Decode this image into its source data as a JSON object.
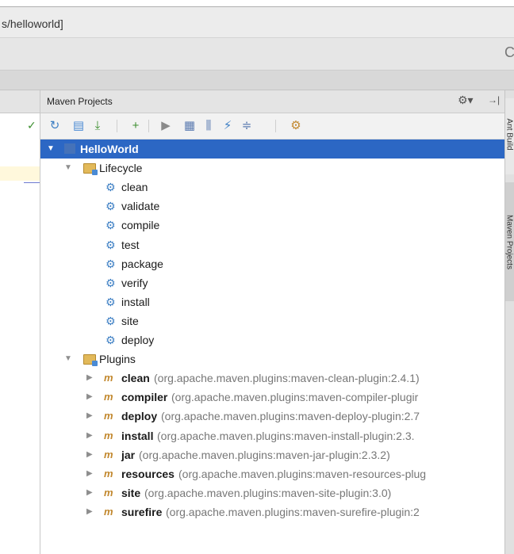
{
  "window": {
    "title": "s/helloworld]",
    "toolbar_cut_glyph": "C"
  },
  "editor": {
    "check_mark": "✓"
  },
  "panel": {
    "title": "Maven Projects",
    "header_icons": [
      "gear-icon",
      "hide-panel-icon"
    ],
    "toolbar": [
      {
        "name": "reimport-button",
        "icon": "refresh-icon",
        "glyph": "↻",
        "color": "#3d7fc4"
      },
      {
        "name": "generate-sources-button",
        "icon": "folder-refresh-icon",
        "glyph": "▤",
        "color": "#4a8ad4"
      },
      {
        "name": "download-sources-button",
        "icon": "download-icon",
        "glyph": "⤓",
        "color": "#3c8f2f"
      },
      {
        "name": "add-project-button",
        "icon": "plus-icon",
        "glyph": "+",
        "color": "#3c8f2f"
      },
      {
        "name": "run-build-button",
        "icon": "play-icon",
        "glyph": "▶",
        "color": "#8a8a8a"
      },
      {
        "name": "execute-goal-button",
        "icon": "maven-goal-icon",
        "glyph": "▦",
        "color": "#5b7bb0"
      },
      {
        "name": "toggle-offline-button",
        "icon": "offline-icon",
        "glyph": "⫼",
        "color": "#5b7bb0"
      },
      {
        "name": "skip-tests-button",
        "icon": "lightning-icon",
        "glyph": "⚡",
        "color": "#3d7fc4"
      },
      {
        "name": "collapse-all-button",
        "icon": "collapse-icon",
        "glyph": "≑",
        "color": "#5b7bb0"
      },
      {
        "name": "settings-button",
        "icon": "maven-settings-icon",
        "glyph": "⚙",
        "color": "#c2882e"
      }
    ]
  },
  "tree": {
    "project": "HelloWorld",
    "lifecycle": {
      "label": "Lifecycle",
      "phases": [
        "clean",
        "validate",
        "compile",
        "test",
        "package",
        "verify",
        "install",
        "site",
        "deploy"
      ]
    },
    "plugins": {
      "label": "Plugins",
      "items": [
        {
          "name": "clean",
          "coords": "(org.apache.maven.plugins:maven-clean-plugin:2.4.1)"
        },
        {
          "name": "compiler",
          "coords": "(org.apache.maven.plugins:maven-compiler-plugir"
        },
        {
          "name": "deploy",
          "coords": "(org.apache.maven.plugins:maven-deploy-plugin:2.7"
        },
        {
          "name": "install",
          "coords": "(org.apache.maven.plugins:maven-install-plugin:2.3."
        },
        {
          "name": "jar",
          "coords": "(org.apache.maven.plugins:maven-jar-plugin:2.3.2)"
        },
        {
          "name": "resources",
          "coords": "(org.apache.maven.plugins:maven-resources-plug"
        },
        {
          "name": "site",
          "coords": "(org.apache.maven.plugins:maven-site-plugin:3.0)"
        },
        {
          "name": "surefire",
          "coords": "(org.apache.maven.plugins:maven-surefire-plugin:2"
        }
      ]
    }
  },
  "right_stripe": {
    "tab1": "Ant Build",
    "tab2": "Maven Projects"
  },
  "colors": {
    "selection": "#2c67c4",
    "gear": "#3d7fc4",
    "plugin": "#c2882e"
  }
}
